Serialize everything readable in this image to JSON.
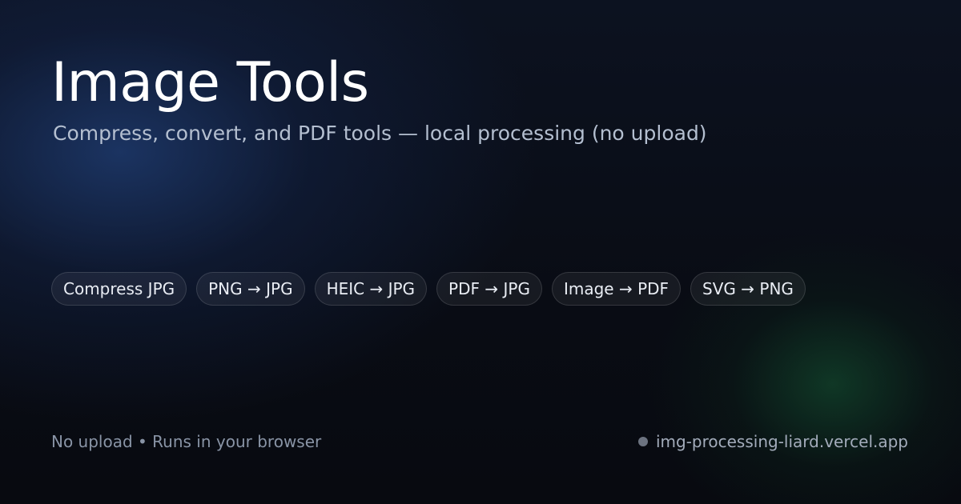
{
  "hero": {
    "title": "Image Tools",
    "subtitle": "Compress, convert, and PDF tools — local processing (no upload)"
  },
  "tools": [
    {
      "label": "Compress JPG"
    },
    {
      "label": "PNG → JPG"
    },
    {
      "label": "HEIC → JPG"
    },
    {
      "label": "PDF → JPG"
    },
    {
      "label": "Image → PDF"
    },
    {
      "label": "SVG → PNG"
    }
  ],
  "footer": {
    "tagline": "No upload • Runs in your browser",
    "site_url": "img-processing-liard.vercel.app",
    "status_icon": "status-dot-icon"
  },
  "colors": {
    "background": "#090c13",
    "glow_blue": "#1e3a6e",
    "glow_green": "#12462c",
    "title": "#ffffff",
    "subtitle": "#b4bfd0",
    "chip_text": "#e9edf4",
    "footer_text": "#8994a6"
  }
}
